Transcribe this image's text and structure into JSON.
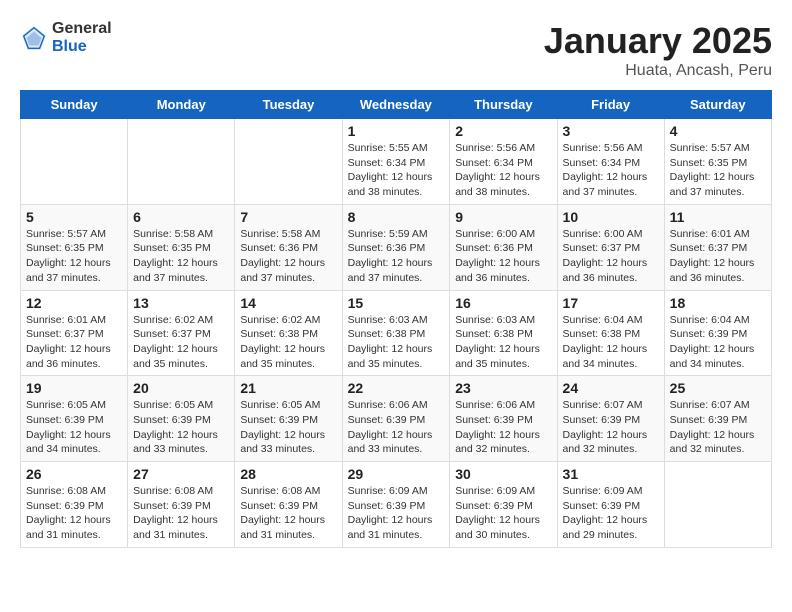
{
  "logo": {
    "general": "General",
    "blue": "Blue"
  },
  "title": "January 2025",
  "subtitle": "Huata, Ancash, Peru",
  "weekdays": [
    "Sunday",
    "Monday",
    "Tuesday",
    "Wednesday",
    "Thursday",
    "Friday",
    "Saturday"
  ],
  "weeks": [
    [
      {
        "day": "",
        "info": ""
      },
      {
        "day": "",
        "info": ""
      },
      {
        "day": "",
        "info": ""
      },
      {
        "day": "1",
        "info": "Sunrise: 5:55 AM\nSunset: 6:34 PM\nDaylight: 12 hours\nand 38 minutes."
      },
      {
        "day": "2",
        "info": "Sunrise: 5:56 AM\nSunset: 6:34 PM\nDaylight: 12 hours\nand 38 minutes."
      },
      {
        "day": "3",
        "info": "Sunrise: 5:56 AM\nSunset: 6:34 PM\nDaylight: 12 hours\nand 37 minutes."
      },
      {
        "day": "4",
        "info": "Sunrise: 5:57 AM\nSunset: 6:35 PM\nDaylight: 12 hours\nand 37 minutes."
      }
    ],
    [
      {
        "day": "5",
        "info": "Sunrise: 5:57 AM\nSunset: 6:35 PM\nDaylight: 12 hours\nand 37 minutes."
      },
      {
        "day": "6",
        "info": "Sunrise: 5:58 AM\nSunset: 6:35 PM\nDaylight: 12 hours\nand 37 minutes."
      },
      {
        "day": "7",
        "info": "Sunrise: 5:58 AM\nSunset: 6:36 PM\nDaylight: 12 hours\nand 37 minutes."
      },
      {
        "day": "8",
        "info": "Sunrise: 5:59 AM\nSunset: 6:36 PM\nDaylight: 12 hours\nand 37 minutes."
      },
      {
        "day": "9",
        "info": "Sunrise: 6:00 AM\nSunset: 6:36 PM\nDaylight: 12 hours\nand 36 minutes."
      },
      {
        "day": "10",
        "info": "Sunrise: 6:00 AM\nSunset: 6:37 PM\nDaylight: 12 hours\nand 36 minutes."
      },
      {
        "day": "11",
        "info": "Sunrise: 6:01 AM\nSunset: 6:37 PM\nDaylight: 12 hours\nand 36 minutes."
      }
    ],
    [
      {
        "day": "12",
        "info": "Sunrise: 6:01 AM\nSunset: 6:37 PM\nDaylight: 12 hours\nand 36 minutes."
      },
      {
        "day": "13",
        "info": "Sunrise: 6:02 AM\nSunset: 6:37 PM\nDaylight: 12 hours\nand 35 minutes."
      },
      {
        "day": "14",
        "info": "Sunrise: 6:02 AM\nSunset: 6:38 PM\nDaylight: 12 hours\nand 35 minutes."
      },
      {
        "day": "15",
        "info": "Sunrise: 6:03 AM\nSunset: 6:38 PM\nDaylight: 12 hours\nand 35 minutes."
      },
      {
        "day": "16",
        "info": "Sunrise: 6:03 AM\nSunset: 6:38 PM\nDaylight: 12 hours\nand 35 minutes."
      },
      {
        "day": "17",
        "info": "Sunrise: 6:04 AM\nSunset: 6:38 PM\nDaylight: 12 hours\nand 34 minutes."
      },
      {
        "day": "18",
        "info": "Sunrise: 6:04 AM\nSunset: 6:39 PM\nDaylight: 12 hours\nand 34 minutes."
      }
    ],
    [
      {
        "day": "19",
        "info": "Sunrise: 6:05 AM\nSunset: 6:39 PM\nDaylight: 12 hours\nand 34 minutes."
      },
      {
        "day": "20",
        "info": "Sunrise: 6:05 AM\nSunset: 6:39 PM\nDaylight: 12 hours\nand 33 minutes."
      },
      {
        "day": "21",
        "info": "Sunrise: 6:05 AM\nSunset: 6:39 PM\nDaylight: 12 hours\nand 33 minutes."
      },
      {
        "day": "22",
        "info": "Sunrise: 6:06 AM\nSunset: 6:39 PM\nDaylight: 12 hours\nand 33 minutes."
      },
      {
        "day": "23",
        "info": "Sunrise: 6:06 AM\nSunset: 6:39 PM\nDaylight: 12 hours\nand 32 minutes."
      },
      {
        "day": "24",
        "info": "Sunrise: 6:07 AM\nSunset: 6:39 PM\nDaylight: 12 hours\nand 32 minutes."
      },
      {
        "day": "25",
        "info": "Sunrise: 6:07 AM\nSunset: 6:39 PM\nDaylight: 12 hours\nand 32 minutes."
      }
    ],
    [
      {
        "day": "26",
        "info": "Sunrise: 6:08 AM\nSunset: 6:39 PM\nDaylight: 12 hours\nand 31 minutes."
      },
      {
        "day": "27",
        "info": "Sunrise: 6:08 AM\nSunset: 6:39 PM\nDaylight: 12 hours\nand 31 minutes."
      },
      {
        "day": "28",
        "info": "Sunrise: 6:08 AM\nSunset: 6:39 PM\nDaylight: 12 hours\nand 31 minutes."
      },
      {
        "day": "29",
        "info": "Sunrise: 6:09 AM\nSunset: 6:39 PM\nDaylight: 12 hours\nand 31 minutes."
      },
      {
        "day": "30",
        "info": "Sunrise: 6:09 AM\nSunset: 6:39 PM\nDaylight: 12 hours\nand 30 minutes."
      },
      {
        "day": "31",
        "info": "Sunrise: 6:09 AM\nSunset: 6:39 PM\nDaylight: 12 hours\nand 29 minutes."
      },
      {
        "day": "",
        "info": ""
      }
    ]
  ]
}
